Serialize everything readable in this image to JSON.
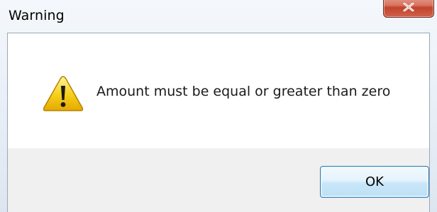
{
  "window": {
    "title": "Warning",
    "close_icon": "close-icon"
  },
  "dialog": {
    "icon": "warning-icon",
    "message": "Amount must be equal or greater than zero",
    "ok_label": "OK"
  },
  "colors": {
    "close_button": "#c7462f",
    "warning_icon_fill": "#f5c400",
    "ok_button_border": "#3c7fb1"
  }
}
